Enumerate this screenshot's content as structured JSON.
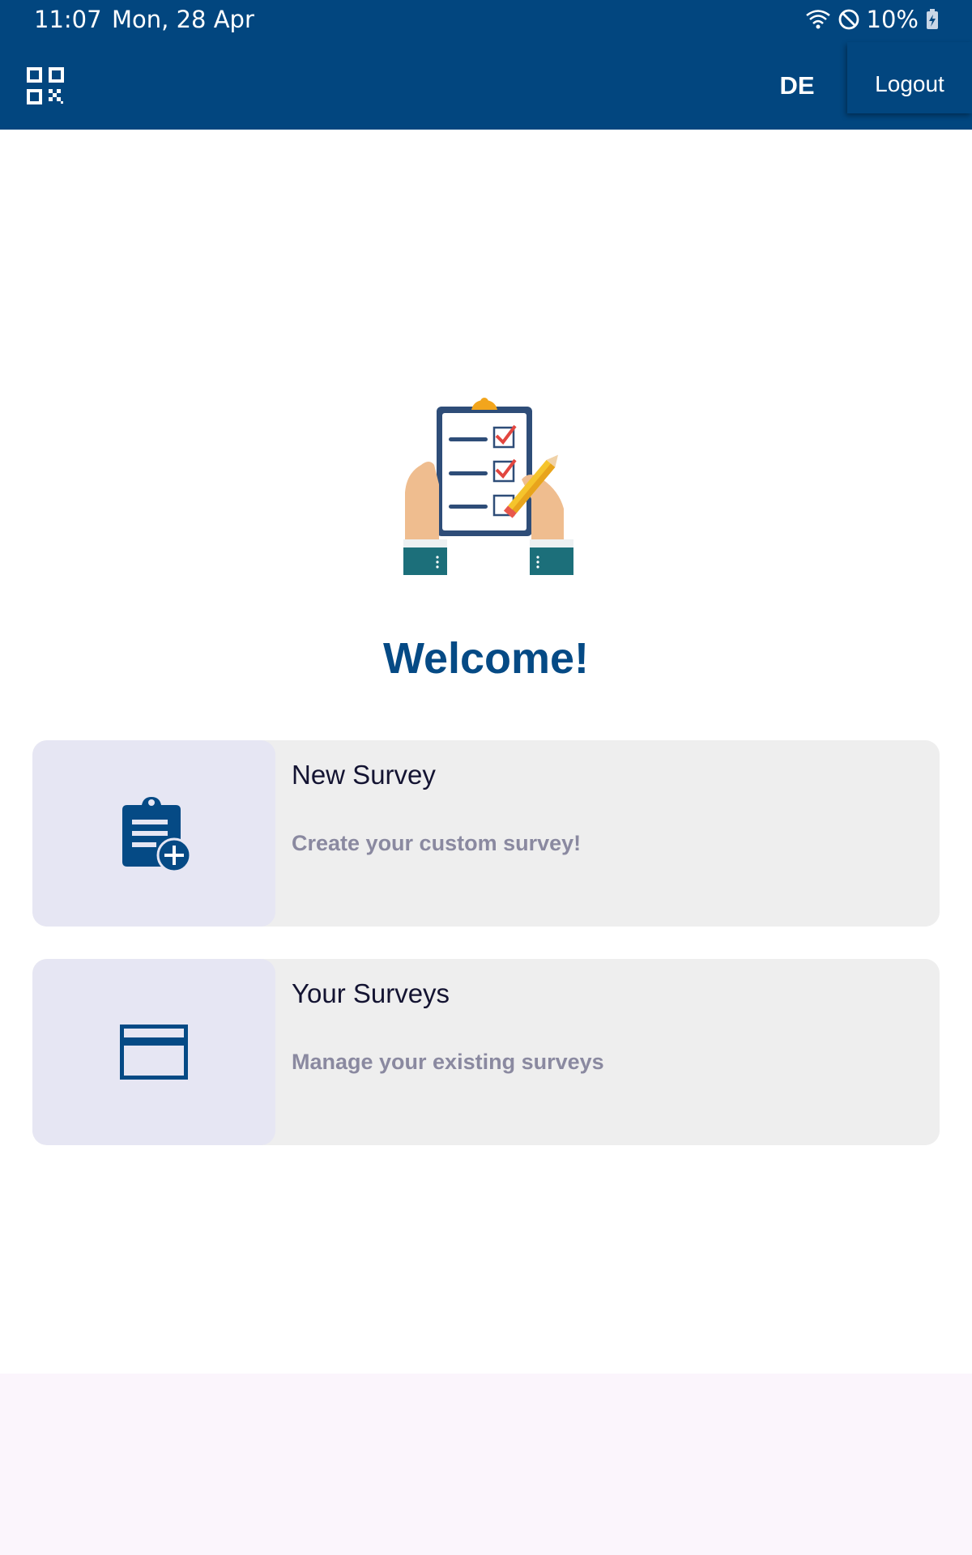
{
  "status_bar": {
    "time": "11:07",
    "date": "Mon, 28 Apr",
    "battery": "10%",
    "icons": [
      "wifi-icon",
      "do-not-disturb-icon",
      "battery-charging-icon"
    ]
  },
  "app_bar": {
    "qr_icon": "qr-code-icon",
    "language": "DE",
    "logout": "Logout",
    "background": "#02467f"
  },
  "hero": {
    "illustration": "clipboard-checklist-illustration"
  },
  "welcome": "Welcome!",
  "cards": [
    {
      "title": "New Survey",
      "subtitle": "Create your custom survey!",
      "icon": "clipboard-add-icon"
    },
    {
      "title": "Your Surveys",
      "subtitle": "Manage your existing surveys",
      "icon": "card-list-icon"
    }
  ],
  "colors": {
    "primary": "#02467f",
    "accent": "#054a85",
    "card_bg": "#eeeeee",
    "icon_panel": "#e6e6f3"
  }
}
